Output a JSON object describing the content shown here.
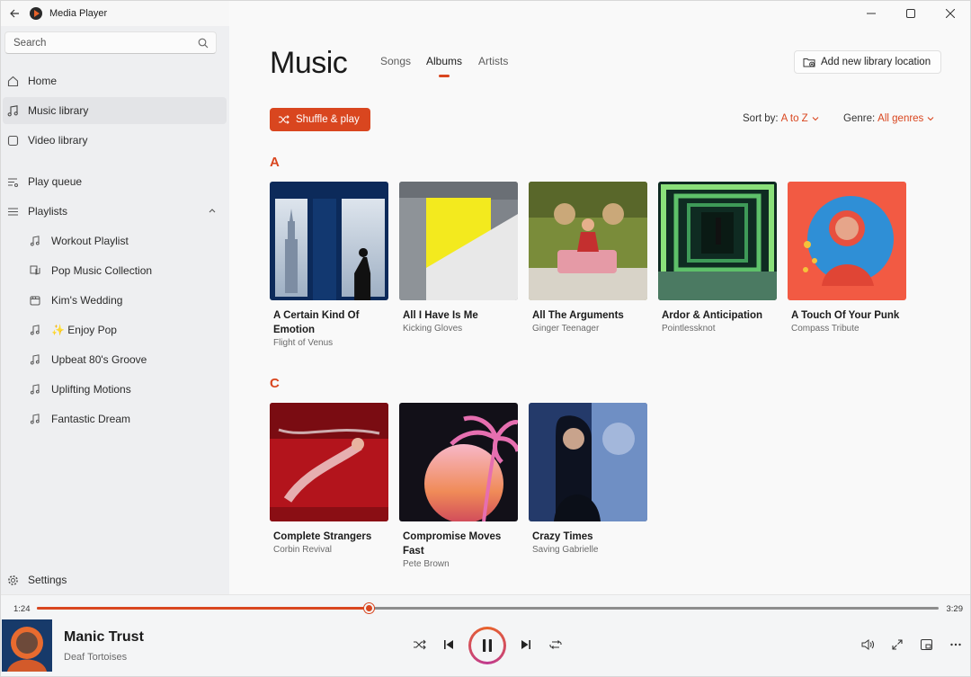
{
  "window": {
    "title": "Media Player"
  },
  "search": {
    "placeholder": "Search"
  },
  "sidebar": {
    "items": [
      {
        "label": "Home"
      },
      {
        "label": "Music library"
      },
      {
        "label": "Video library"
      },
      {
        "label": "Play queue"
      },
      {
        "label": "Playlists"
      }
    ],
    "playlists": [
      {
        "label": "Workout Playlist"
      },
      {
        "label": "Pop Music Collection"
      },
      {
        "label": "Kim's Wedding"
      },
      {
        "label": "✨ Enjoy Pop"
      },
      {
        "label": "Upbeat 80's Groove"
      },
      {
        "label": "Uplifting Motions"
      },
      {
        "label": "Fantastic Dream"
      }
    ],
    "settings": "Settings"
  },
  "main": {
    "title": "Music",
    "tabs": [
      {
        "label": "Songs"
      },
      {
        "label": "Albums"
      },
      {
        "label": "Artists"
      }
    ],
    "add_location": "Add new library location",
    "shuffle": "Shuffle & play",
    "sort_label": "Sort by:",
    "sort_value": "A to Z",
    "genre_label": "Genre:",
    "genre_value": "All genres",
    "groups": [
      {
        "letter": "A",
        "albums": [
          {
            "title": "A Certain Kind Of Emotion",
            "artist": "Flight of Venus"
          },
          {
            "title": "All I Have Is Me",
            "artist": "Kicking Gloves"
          },
          {
            "title": "All The Arguments",
            "artist": "Ginger Teenager"
          },
          {
            "title": "Ardor & Anticipation",
            "artist": "Pointlessknot"
          },
          {
            "title": "A Touch Of Your Punk",
            "artist": "Compass Tribute"
          }
        ]
      },
      {
        "letter": "C",
        "albums": [
          {
            "title": "Complete Strangers",
            "artist": "Corbin Revival"
          },
          {
            "title": "Compromise Moves Fast",
            "artist": "Pete Brown"
          },
          {
            "title": "Crazy Times",
            "artist": "Saving Gabrielle"
          }
        ]
      }
    ]
  },
  "player": {
    "elapsed": "1:24",
    "total": "3:29",
    "progress": 0.368,
    "track": "Manic Trust",
    "artist": "Deaf Tortoises"
  },
  "colors": {
    "accent": "#d9461f"
  }
}
